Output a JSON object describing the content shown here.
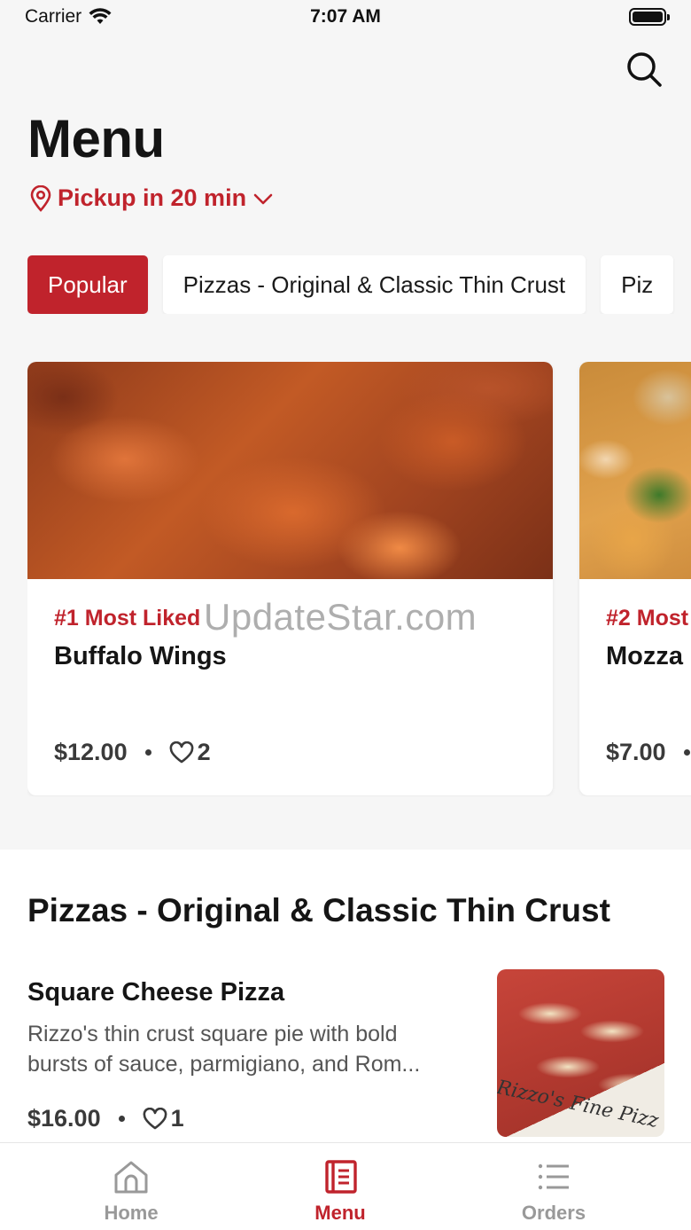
{
  "status_bar": {
    "carrier": "Carrier",
    "time": "7:07 AM"
  },
  "header": {
    "title": "Menu",
    "pickup_label": "Pickup in 20 min"
  },
  "category_tabs": [
    {
      "label": "Popular",
      "active": true
    },
    {
      "label": "Pizzas - Original & Classic Thin Crust",
      "active": false
    },
    {
      "label": "Piz",
      "active": false
    }
  ],
  "popular_items": [
    {
      "rank": "#1 Most Liked",
      "name": "Buffalo Wings",
      "price": "$12.00",
      "likes": "2"
    },
    {
      "rank": "#2 Most",
      "name": "Mozza",
      "price": "$7.00",
      "likes": ""
    }
  ],
  "watermark": "UpdateStar.com",
  "section": {
    "title": "Pizzas - Original & Classic Thin Crust",
    "items": [
      {
        "name": "Square Cheese Pizza",
        "description": "Rizzo's thin crust square pie with bold bursts of sauce, parmigiano, and Rom...",
        "price": "$16.00",
        "likes": "1",
        "image_text": "Rizzo's Fine Pizz"
      }
    ]
  },
  "tab_bar": [
    {
      "label": "Home",
      "active": false
    },
    {
      "label": "Menu",
      "active": true
    },
    {
      "label": "Orders",
      "active": false
    }
  ],
  "colors": {
    "accent": "#c0232c",
    "background": "#f6f6f6",
    "inactive_tab": "#999999"
  }
}
